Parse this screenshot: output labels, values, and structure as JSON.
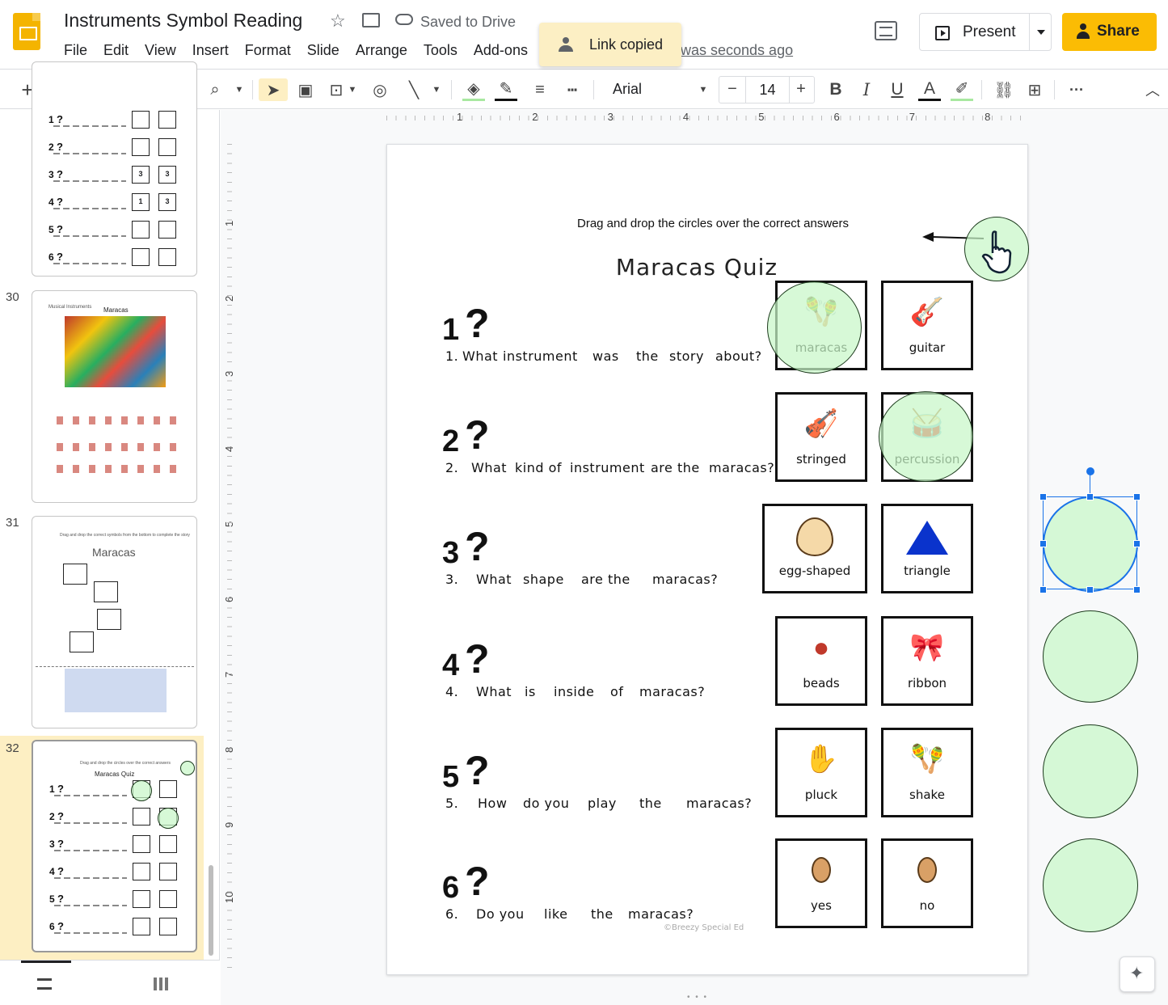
{
  "header": {
    "title": "Instruments Symbol Reading",
    "saved_status": "Saved to Drive",
    "menu": [
      "File",
      "Edit",
      "View",
      "Insert",
      "Format",
      "Slide",
      "Arrange",
      "Tools",
      "Add-ons"
    ],
    "last_edit": "was seconds ago",
    "toast": "Link copied",
    "present_label": "Present",
    "share_label": "Share"
  },
  "toolbar": {
    "font_name": "Arial",
    "font_size": "14",
    "minus": "−",
    "plus": "+",
    "bold": "B",
    "italic": "I",
    "underline": "U",
    "text_color": "A",
    "more": "···",
    "plus_new": "+"
  },
  "filmstrip": {
    "slides": [
      {
        "number": "30",
        "title": "Maracas",
        "header": "Musical Instruments"
      },
      {
        "number": "31",
        "title": "Maracas",
        "header": "Drag and drop the correct symbols from the bottom to complete the story"
      },
      {
        "number": "32",
        "title": "Maracas Quiz",
        "header": "Drag and drop the circles over the correct answers"
      }
    ],
    "top_rows": [
      "1",
      "2",
      "3",
      "4",
      "5",
      "6"
    ],
    "top_boxes": [
      [
        "",
        ""
      ],
      [
        "",
        ""
      ],
      [
        "3",
        "3"
      ],
      [
        "1",
        "3"
      ],
      [
        "",
        ""
      ],
      [
        "",
        ""
      ]
    ]
  },
  "ruler": {
    "top": [
      "1",
      "2",
      "3",
      "4",
      "5",
      "6",
      "7",
      "8"
    ],
    "left": [
      "1",
      "2",
      "3",
      "4",
      "5",
      "6",
      "7",
      "8",
      "9",
      "10"
    ]
  },
  "slide": {
    "instruction": "Drag and drop the circles over the correct answers",
    "title": "Maracas Quiz",
    "questions": [
      {
        "num": "1",
        "words": [
          "1.",
          "What",
          "instrument",
          "was",
          "the",
          "story",
          "about?"
        ],
        "answers": [
          "maracas",
          "guitar"
        ]
      },
      {
        "num": "2",
        "words": [
          "2.",
          "What",
          "kind of",
          "instrument",
          "are the",
          "maracas?"
        ],
        "answers": [
          "stringed",
          "percussion"
        ]
      },
      {
        "num": "3",
        "words": [
          "3.",
          "What",
          "shape",
          "are the",
          "maracas?"
        ],
        "answers": [
          "egg-shaped",
          "triangle"
        ]
      },
      {
        "num": "4",
        "words": [
          "4.",
          "What",
          "is",
          "inside",
          "of",
          "maracas?"
        ],
        "answers": [
          "beads",
          "ribbon"
        ]
      },
      {
        "num": "5",
        "words": [
          "5.",
          "How",
          "do you",
          "play",
          "the",
          "maracas?"
        ],
        "answers": [
          "pluck",
          "shake"
        ]
      },
      {
        "num": "6",
        "words": [
          "6.",
          "Do you",
          "like",
          "the",
          "maracas?"
        ],
        "answers": [
          "yes",
          "no"
        ]
      }
    ],
    "credit": "©Breezy Special Ed"
  },
  "colors": {
    "accent": "#fbbc04",
    "circle_fill": "#c8f6c8",
    "selection": "#1a73e8",
    "filmstrip_highlight": "#fdefc3"
  }
}
